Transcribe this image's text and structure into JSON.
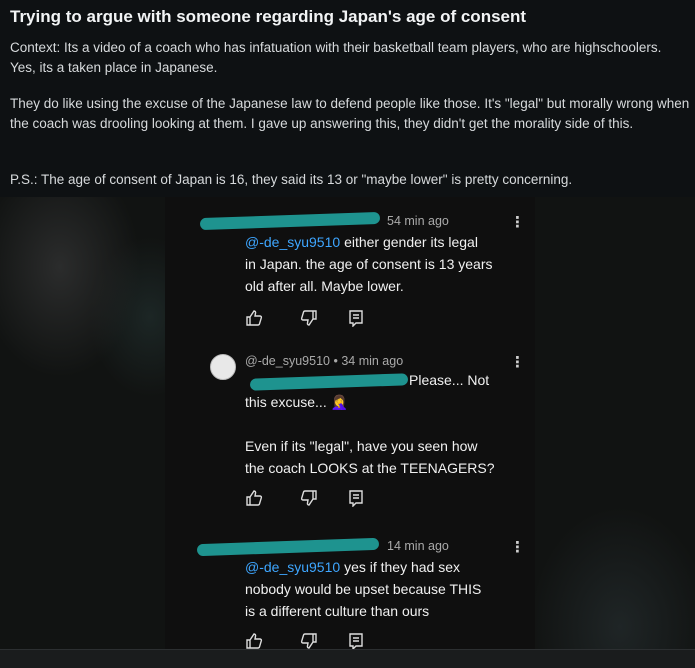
{
  "post": {
    "title": "Trying to argue with someone regarding Japan's age of consent",
    "paragraphs": [
      "Context: Its a video of a coach who has infatuation with their basketball team players, who are highschoolers. Yes, its a taken place in Japanese.",
      "They do like using the excuse of the Japanese law to defend people like those. It's \"legal\" but morally wrong when the coach was drooling looking at them. I gave up answering this, they didn't get the morality side of this.",
      "P.S.: The age of consent of Japan is 16, they said its 13 or \"maybe lower\" is pretty concerning."
    ]
  },
  "comments": [
    {
      "time": "54 min ago",
      "mention": "@-de_syu9510",
      "lines": [
        "either gender its legal",
        "in Japan. the age of consent is 13 years",
        "old after all. Maybe lower."
      ]
    },
    {
      "author": "@-de_syu9510",
      "time": "34 min ago",
      "lines": [
        "Please... Not",
        "this excuse... 🤦‍♀️",
        "",
        "Even if its \"legal\", have you seen how",
        "the coach LOOKS at the TEENAGERS?"
      ]
    },
    {
      "time": "14 min ago",
      "mention": "@-de_syu9510",
      "lines": [
        "yes if they had sex",
        "nobody would be upset because THIS",
        "is a different culture than ours"
      ]
    }
  ],
  "icons": [
    "like-icon",
    "dislike-icon",
    "reply-icon",
    "more-options-icon",
    "avatar"
  ],
  "colors": {
    "mention": "#3ea6ff",
    "redaction": "#1f9e9a",
    "background": "#0e1113"
  }
}
